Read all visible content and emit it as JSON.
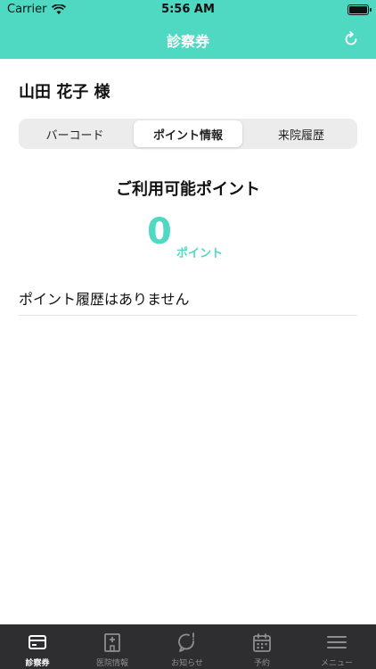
{
  "status_bar": {
    "carrier": "Carrier",
    "time": "5:56 AM"
  },
  "header": {
    "title": "診察券",
    "refresh_icon": "refresh-icon",
    "color": "#4fd9c3"
  },
  "user": {
    "name": "山田 花子 様"
  },
  "segments": [
    "バーコード",
    "ポイント情報",
    "来院履歴"
  ],
  "selected_segment": "ポイント情報",
  "points": {
    "title": "ご利用可能ポイント",
    "value": "0",
    "unit": "ポイント"
  },
  "history": {
    "empty_message": "ポイント履歴はありません"
  },
  "tabbar": {
    "items": [
      {
        "label": "診察券",
        "icon": "card-icon",
        "active": true
      },
      {
        "label": "医院情報",
        "icon": "hospital-icon",
        "active": false
      },
      {
        "label": "お知らせ",
        "icon": "notification-icon",
        "active": false
      },
      {
        "label": "予約",
        "icon": "calendar-icon",
        "active": false
      },
      {
        "label": "メニュー",
        "icon": "menu-icon",
        "active": false
      }
    ]
  }
}
